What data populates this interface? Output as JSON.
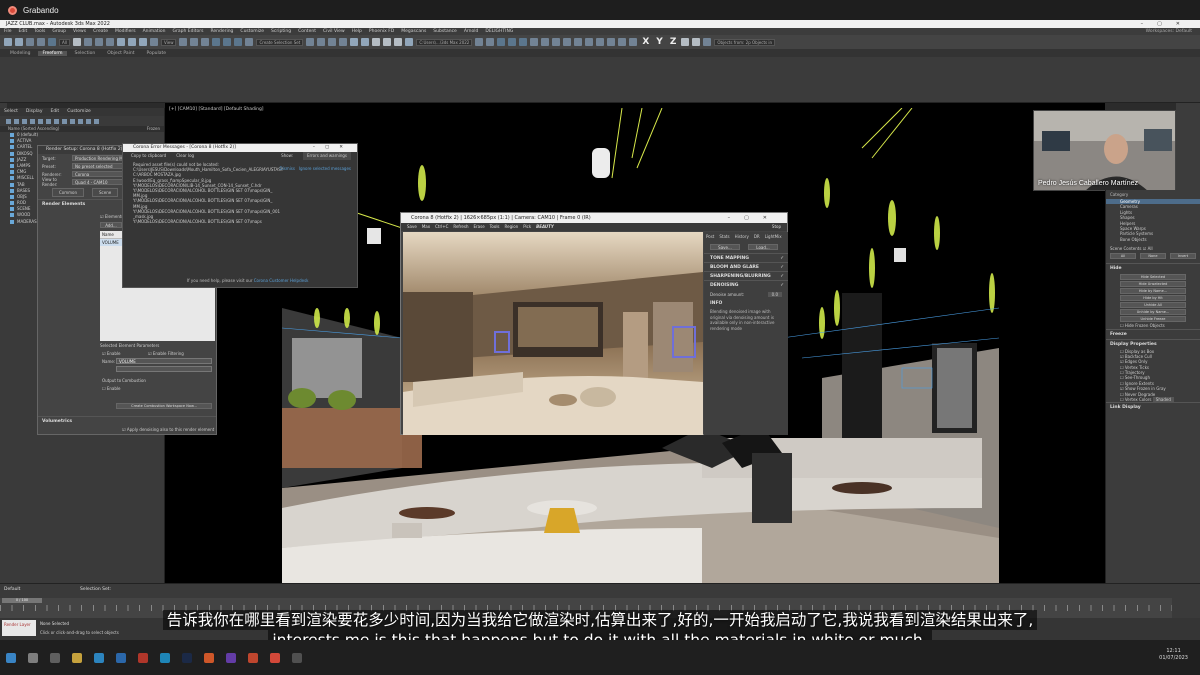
{
  "recorder": {
    "title": "Grabando"
  },
  "window": {
    "title": "JAZZ CLUB.max - Autodesk 3ds Max 2022",
    "workspaces_label": "Workspaces: Default"
  },
  "menu": [
    "File",
    "Edit",
    "Tools",
    "Group",
    "Views",
    "Create",
    "Modifiers",
    "Animation",
    "Graph Editors",
    "Rendering",
    "Customize",
    "Scripting",
    "Content",
    "Civil View",
    "Help",
    "Phoenix FD",
    "Megascans",
    "Substance",
    "Arnold",
    "DELIGHTING"
  ],
  "toolbar": {
    "filter": "All",
    "view": "View",
    "selset": "Create Selection Set",
    "objects_from": "Objects from: 2p Objects in"
  },
  "ribbon": [
    "Modeling",
    "Freeform",
    "Selection",
    "Object Paint",
    "Populate"
  ],
  "scene_explorer": {
    "menu": [
      "Select",
      "Display",
      "Edit",
      "Customize"
    ],
    "header": "Name (Sorted Ascending)",
    "frozen": "Frozen",
    "rows": [
      "0 (default)",
      "ACTIVA",
      "CARTEL",
      "DIKOSQ",
      "JAZZ",
      "LAMPS",
      "CMG",
      "MISCELL",
      "TAB",
      "BASES",
      "OBJS",
      "ROD",
      "SCENE",
      "WOOD",
      "MADERAS"
    ]
  },
  "viewport": {
    "label": "[+] [CAM10] [Standard] [Default Shading]"
  },
  "render_setup": {
    "title": "Render Setup: Corona 8 (Hotfix 2)",
    "fields": [
      {
        "label": "Target:",
        "value": "Production Rendering Mode"
      },
      {
        "label": "Preset:",
        "value": "No preset selected"
      },
      {
        "label": "Renderer:",
        "value": "Corona"
      },
      {
        "label": "View to Render:",
        "value": "Quad 4 - CAM10"
      }
    ],
    "tabs": [
      "Common",
      "Scene"
    ],
    "section": "Render Elements",
    "elements_label": "Elements Active",
    "add_label": "Add...",
    "list_header": "Name",
    "list_item": "VOLUME",
    "params_title": "Selected Element Parameters",
    "enable": "Enable",
    "enable_filter": "Enable Filtering",
    "name_label": "Name:",
    "name_value": "VOLUME",
    "output_to": "Output to",
    "combustion": "Combustion",
    "enable2": "Enable",
    "create_combustion": "Create Combustion Workspace Now...",
    "volumetrics": "Volumetrics",
    "denoise_check": "Apply denoising also to this render element"
  },
  "missing_dialog": {
    "title": "Corona Error Messages - [Corona 8 (Hotfix 2)]",
    "copy": "Copy to clipboard",
    "clear": "Clear log",
    "show_label": "Show:",
    "show_value": "Errors and warnings",
    "dismiss": "Dismiss",
    "ignore": "Ignore selected messages",
    "message": "Required asset file(s) could not be located:",
    "paths": [
      "C:\\Users\\JESUS\\Downloads\\Mouth_Hamilton_Sofa_Cecien_ALEGRIAYUSTASY",
      "C:\\ARBOC MOSTAZA.jpg",
      "E:\\wood\\Eq_grass_f\\ampSpecular_8.jpg",
      "Y:\\MODELOS\\DECORACION\\LIB-14_Sunset_CON-14_Sunset_C.hdr",
      "Y:\\MODELOS\\DECORACION\\ALCOHOL BOTTLES\\GIN SET 07\\maps\\GIN_",
      "MM.jpg",
      "Y:\\MODELOS\\DECORACION\\ALCOHOL BOTTLES\\GIN SET 07\\maps\\GIN_",
      "MM.jpg",
      "Y:\\MODELOS\\DECORACION\\ALCOHOL BOTTLES\\GIN SET 07\\maps\\GIN_001",
      "_mask.jpg",
      "Y:\\MODELOS\\DECORACION\\ALCOHOL BOTTLES\\GIN SET 07\\maps"
    ],
    "footer": "If you need help, please visit our",
    "footer_link": "Corona Customer Helpdesk"
  },
  "vfb": {
    "title": "Corona 8 (Hotfix 2) | 1626×685px (1:1) | Camera: CAM10 | Frame 0 (IR)",
    "toolbar": [
      "Save",
      "Max",
      "Ctrl+C",
      "Refresh",
      "Erase",
      "Tools",
      "Region",
      "Pick",
      "BEAUTY",
      "Stop"
    ],
    "tabs": [
      "Post",
      "Stats",
      "History",
      "DR",
      "LightMix"
    ],
    "save": "Save...",
    "load": "Load...",
    "sections": [
      "TONE MAPPING",
      "BLOOM AND GLARE",
      "SHARPENING/BLURRING",
      "DENOISING"
    ],
    "denoise_label": "Denoise amount:",
    "denoise_value": "0.0",
    "info_title": "INFO",
    "info_text": "Blending denoised image with original via denoising amount is available only in non-interactive rendering mode"
  },
  "webcam": {
    "name": "Pedro Jesús Caballero Martínez"
  },
  "command_panel": {
    "category": "Category",
    "items": [
      "Geometry",
      "Cameras",
      "Lights",
      "Shapes",
      "Helpers",
      "Space Warps",
      "Particle Systems",
      "Bone Objects"
    ],
    "scene_contents": "Scene Contents",
    "all": "All",
    "buttons": [
      "All",
      "None",
      "Invert"
    ],
    "hide_title": "Hide",
    "hide_buttons": [
      "Hide Selected",
      "Hide Unselected",
      "Hide by Name...",
      "Hide by Hit",
      "Unhide All",
      "Unhide by Name...",
      "Unhide Freeze"
    ],
    "hide_frozen": "Hide Frozen Objects",
    "freeze": "Freeze",
    "display_props": "Display Properties",
    "props": [
      "Display as Box",
      "Backface Cull",
      "Edges Only",
      "Vertex Ticks",
      "Trajectory",
      "See-Through",
      "Ignore Extents",
      "Show Frozen in Gray",
      "Never Degrade",
      "Vertex Colors"
    ],
    "shaded": "Shaded",
    "link_display": "Link Display"
  },
  "bottom": {
    "layer": "Default",
    "selset": "Selection Set:",
    "frames": "0 / 100",
    "maxscript": "Render Layer",
    "selection_status": "None Selected",
    "hint": "Click or click-and-drag to select objects"
  },
  "subtitles": {
    "zh": "告诉我你在哪里看到渲染要花多少时间,因为当我给它做渲染时,估算出来了,好的,一开始我启动了它,我说我看到渲染结果出来了,",
    "en": "interests me is this that happens but to do it with all the materials in white or much,"
  },
  "taskbar": {
    "time": "12:11",
    "date": "01/07/2023"
  },
  "colors": {
    "accent": "#4d6c8a",
    "recorder": "#d94a3a",
    "wire": "#d7e84a"
  }
}
